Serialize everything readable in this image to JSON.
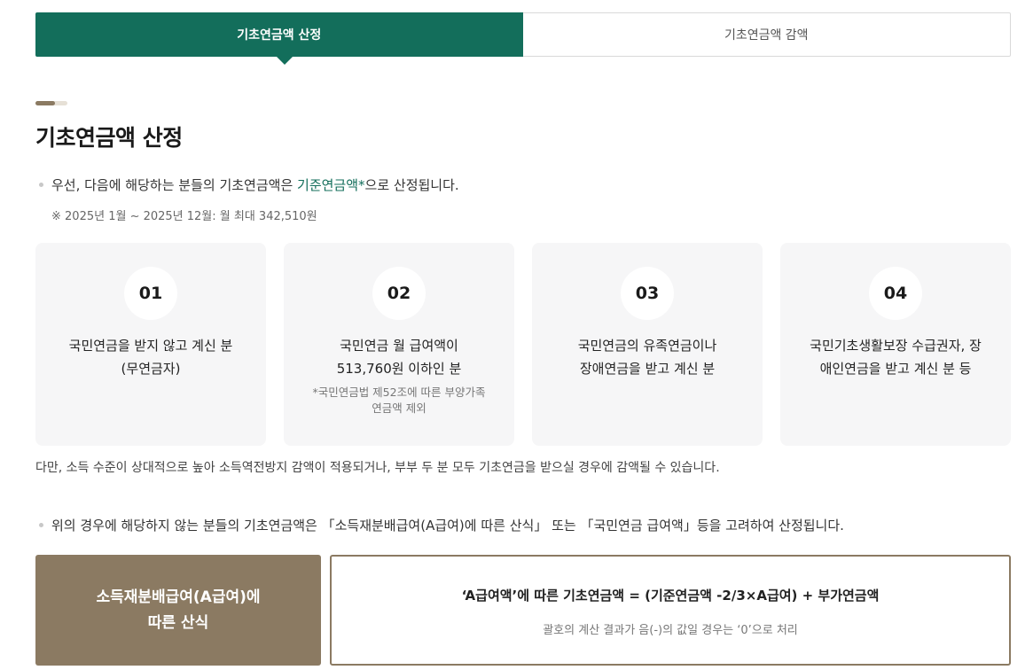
{
  "tabs": [
    {
      "label": "기초연금액 산정",
      "active": true
    },
    {
      "label": "기초연금액 감액",
      "active": false
    }
  ],
  "page_title": "기초연금액 산정",
  "bullet1": {
    "prefix": "우선, 다음에 해당하는 분들의 기초연금액은 ",
    "highlight": "기준연금액*",
    "suffix": "으로 산정됩니다."
  },
  "note": "※ 2025년 1월 ~ 2025년 12월: 월 최대 342,510원",
  "cards": [
    {
      "number": "01",
      "line1": "국민연금을 받지 않고 계신 분",
      "line2": "(무연금자)",
      "sub1": "",
      "sub2": ""
    },
    {
      "number": "02",
      "line1": "국민연금 월 급여액이",
      "line2": "513,760원 이하인 분",
      "sub1": "*국민연금법 제52조에 따른 부양가족",
      "sub2": "연금액 제외"
    },
    {
      "number": "03",
      "line1": "국민연금의 유족연금이나",
      "line2": "장애연금을 받고 계신 분",
      "sub1": "",
      "sub2": ""
    },
    {
      "number": "04",
      "line1": "국민기초생활보장 수급권자, 장",
      "line2": "애인연금을 받고 계신 분 등",
      "sub1": "",
      "sub2": ""
    }
  ],
  "info_text": "다만, 소득 수준이 상대적으로 높아 소득역전방지 감액이 적용되거나, 부부 두 분 모두 기초연금을 받으실 경우에 감액될 수 있습니다.",
  "bullet2": "위의 경우에 해당하지 않는 분들의 기초연금액은 「소득재분배급여(A급여)에 따른 산식」 또는 「국민연금 급여액」등을 고려하여 산정됩니다.",
  "formula": {
    "label_line1": "소득재분배급여(A급여)에",
    "label_line2": "따른 산식",
    "text": "‘A급여액’에 따른 기초연금액 = (기준연금액 -2/3×A급여) + 부가연금액",
    "note": "괄호의 계산 결과가 음(-)의 값일 경우는 ‘0’으로 처리"
  },
  "colors": {
    "brand_green": "#136e5b",
    "accent_brown": "#8b7a62",
    "card_bg": "#f6f6f7"
  }
}
